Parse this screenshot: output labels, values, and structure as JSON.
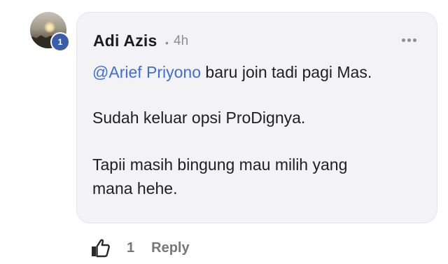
{
  "comment": {
    "author": "Adi Azis",
    "separator": "•",
    "time": "4h",
    "badge": "1",
    "mention": "@Arief Priyono",
    "line1_rest": " baru join tadi pagi Mas.",
    "line2": "Sudah keluar opsi ProDignya.",
    "line3a": "Tapii masih bingung mau milih yang",
    "line3b": "mana hehe."
  },
  "actions": {
    "like_count": "1",
    "reply_label": "Reply"
  },
  "icons": {
    "more": "more-horizontal-icon",
    "like": "thumbs-up-icon"
  },
  "colors": {
    "bubble_bg": "#f3f3f5",
    "mention": "#3e6fd6",
    "badge": "#3b5bab",
    "muted": "#8e8e93"
  }
}
